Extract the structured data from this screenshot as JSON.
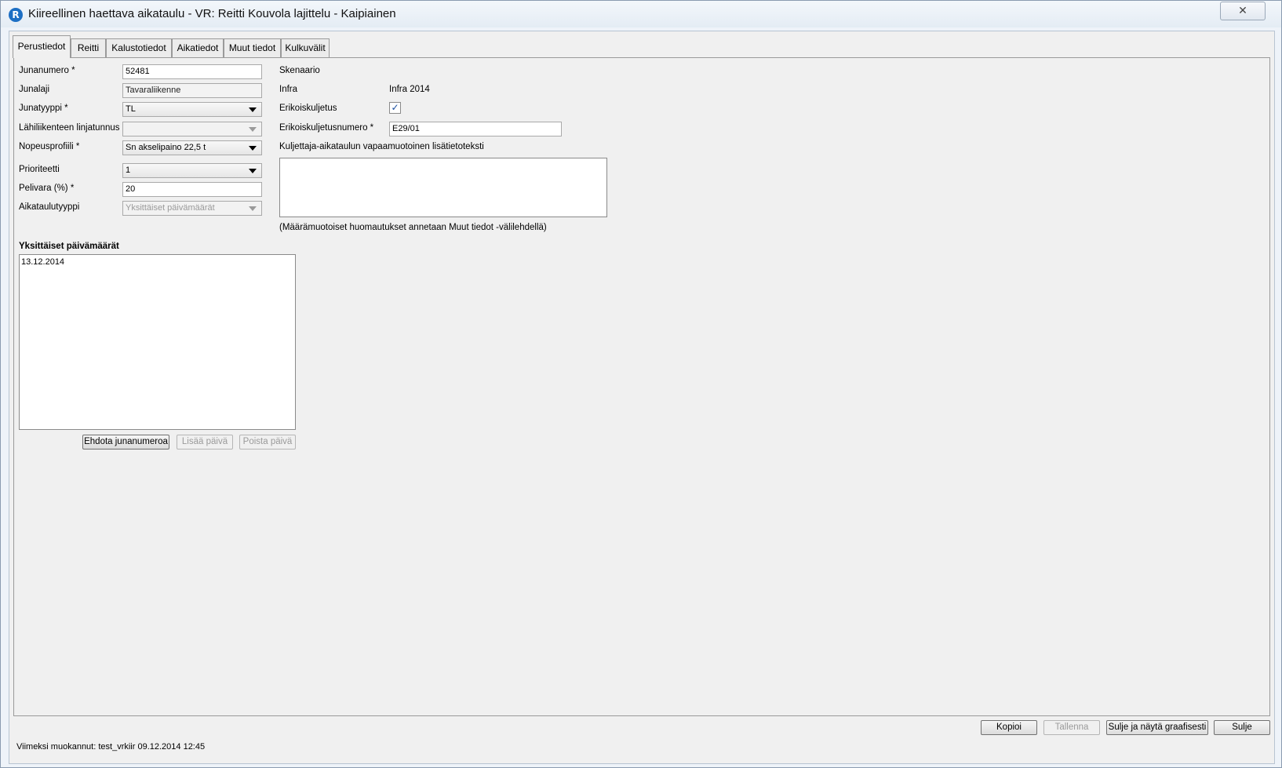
{
  "window": {
    "title": "Kiireellinen haettava aikataulu - VR: Reitti Kouvola lajittelu - Kaipiainen",
    "close_glyph": "✕",
    "app_icon_glyph": "R"
  },
  "tabs": [
    {
      "label": "Perustiedot",
      "active": true
    },
    {
      "label": "Reitti"
    },
    {
      "label": "Kalustotiedot"
    },
    {
      "label": "Aikatiedot"
    },
    {
      "label": "Muut tiedot"
    },
    {
      "label": "Kulkuvälit"
    }
  ],
  "form": {
    "junanumero": {
      "label": "Junanumero *",
      "value": "52481"
    },
    "junalaji": {
      "label": "Junalaji",
      "value": "Tavaraliikenne"
    },
    "junatyyppi": {
      "label": "Junatyyppi *",
      "value": "TL"
    },
    "linjatunnus": {
      "label": "Lähiliikenteen linjatunnus *",
      "value": ""
    },
    "nopeusprofiili": {
      "label": "Nopeusprofiili *",
      "value": "Sn akselipaino 22,5 t"
    },
    "prioriteetti": {
      "label": "Prioriteetti",
      "value": "1"
    },
    "pelivara": {
      "label": "Pelivara (%) *",
      "value": "20"
    },
    "aikataulutyyppi": {
      "label": "Aikataulutyyppi",
      "value": "Yksittäiset päivämäärät"
    },
    "skenaario": {
      "label": "Skenaario",
      "value": ""
    },
    "infra": {
      "label": "Infra",
      "value": "Infra 2014"
    },
    "erikoiskuljetus": {
      "label": "Erikoiskuljetus",
      "checked": true,
      "check_glyph": "✓"
    },
    "erikoiskuljetusnumero": {
      "label": "Erikoiskuljetusnumero *",
      "value": "E29/01"
    },
    "lisatieto": {
      "label": "Kuljettaja-aikataulun vapaamuotoinen lisätietoteksti",
      "value": ""
    },
    "note": "(Määrämuotoiset huomautukset annetaan Muut tiedot -välilehdellä)"
  },
  "dates": {
    "heading": "Yksittäiset päivämäärät",
    "items": [
      "13.12.2014"
    ],
    "buttons": {
      "suggest": "Ehdota junanumeroa",
      "add": "Lisää päivä",
      "remove": "Poista päivä"
    }
  },
  "footer": {
    "buttons": {
      "copy": "Kopioi",
      "save": "Tallenna",
      "close_graphic": "Sulje ja näytä graafisesti",
      "close": "Sulje"
    },
    "last_modified": "Viimeksi muokannut: test_vrkiir 09.12.2014 12:45"
  }
}
